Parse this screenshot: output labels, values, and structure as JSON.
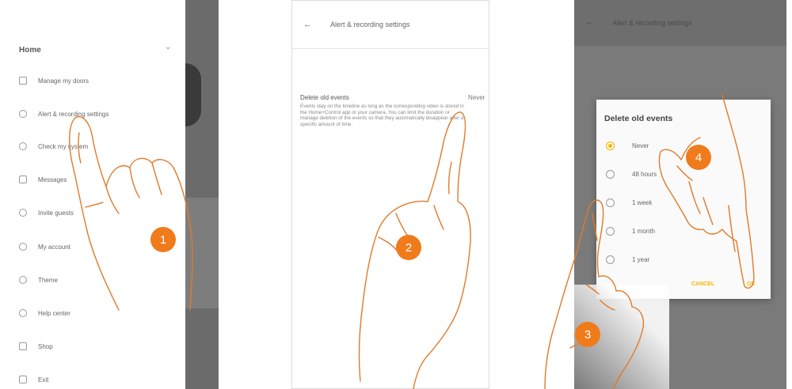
{
  "panel1": {
    "drawer_title": "Home",
    "menu": [
      {
        "label": "Manage my doors",
        "icon": "door-icon"
      },
      {
        "label": "Alert & recording settings",
        "icon": "alert-settings-icon"
      },
      {
        "label": "Check my system",
        "icon": "check-icon"
      },
      {
        "label": "Messages",
        "icon": "messages-icon"
      },
      {
        "label": "Invite guests",
        "icon": "invite-icon"
      },
      {
        "label": "My account",
        "icon": "account-icon"
      },
      {
        "label": "Theme",
        "icon": "theme-icon"
      },
      {
        "label": "Help center",
        "icon": "help-icon"
      },
      {
        "label": "Shop",
        "icon": "shop-icon"
      },
      {
        "label": "Exit",
        "icon": "exit-icon"
      }
    ]
  },
  "panel2": {
    "title": "Alert & recording settings",
    "setting_label": "Delete old events",
    "setting_value": "Never",
    "description": "Events stay on the timeline as long as the corresponding video is stored in the Home+Control app or your camera. You can limit the duration or manage deletion of the events so that they automatically disappear after a specific amount of time."
  },
  "panel3": {
    "title": "Alert & recording settings",
    "dialog_title": "Delete old events",
    "options": [
      "Never",
      "48 hours",
      "1 week",
      "1 month",
      "1 year"
    ],
    "selected_index": 0,
    "cancel_label": "CANCEL",
    "ok_label": "OK"
  },
  "markers": [
    "1",
    "2",
    "3",
    "4"
  ],
  "colors": {
    "marker": "#ef7b1a",
    "accent": "#f5b800",
    "hand_outline": "#e07a2a"
  }
}
